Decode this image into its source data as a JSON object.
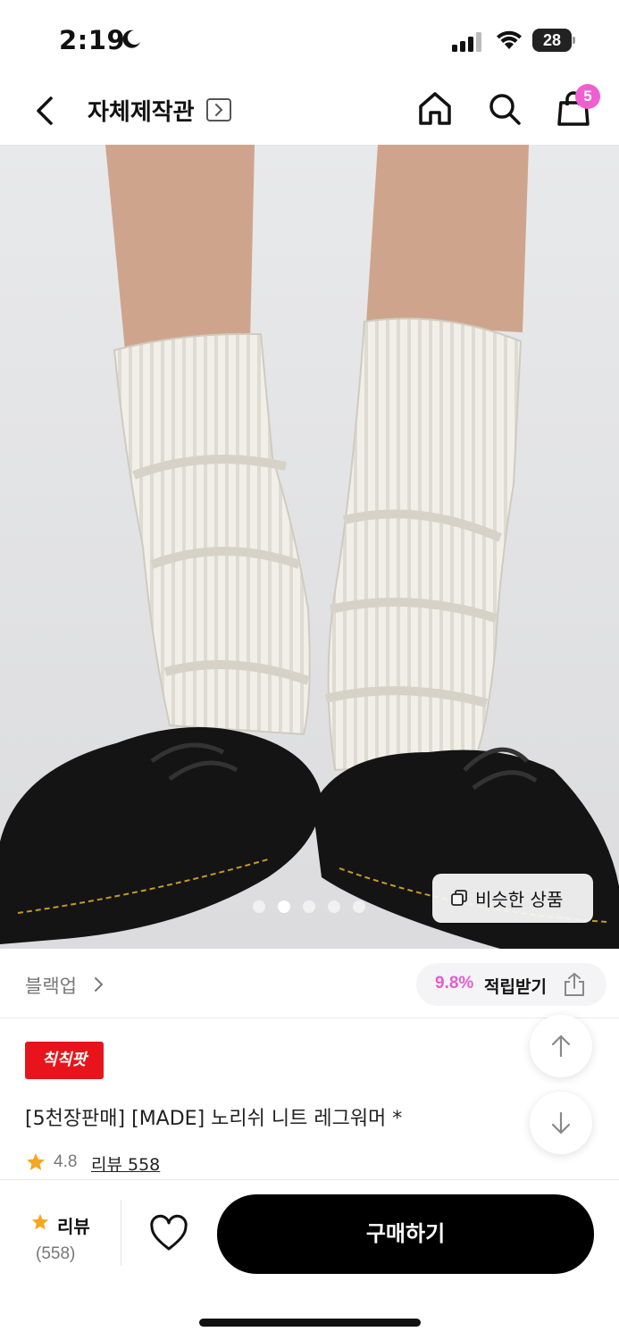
{
  "status": {
    "time": "2:19",
    "battery": "28"
  },
  "header": {
    "store_title": "자체제작관",
    "cart_count": "5"
  },
  "icons": {
    "back": "chevron-left-icon",
    "home": "home-icon",
    "search": "search-icon",
    "cart": "shopping-bag-icon",
    "share": "share-icon",
    "heart": "heart-icon",
    "star": "star-icon"
  },
  "gallery": {
    "similar_label": "비슷한 상품",
    "slide_count": 5,
    "active_slide": 2
  },
  "brand": {
    "name": "블랙업",
    "points_percent": "9.8%",
    "points_label": "적립받기"
  },
  "product": {
    "badge": "칙칙팟",
    "title": "[5천장판매] [MADE] 노리쉬 니트 레그워머 *",
    "rating": "4.8",
    "review_link": "리뷰 558"
  },
  "bottom_bar": {
    "review_label": "리뷰",
    "review_count": "(558)",
    "buy_label": "구매하기"
  },
  "colors": {
    "accent": "#e25fd0",
    "badge_red": "#e8141b",
    "star": "#f5a623",
    "buy_button": "#000000"
  }
}
